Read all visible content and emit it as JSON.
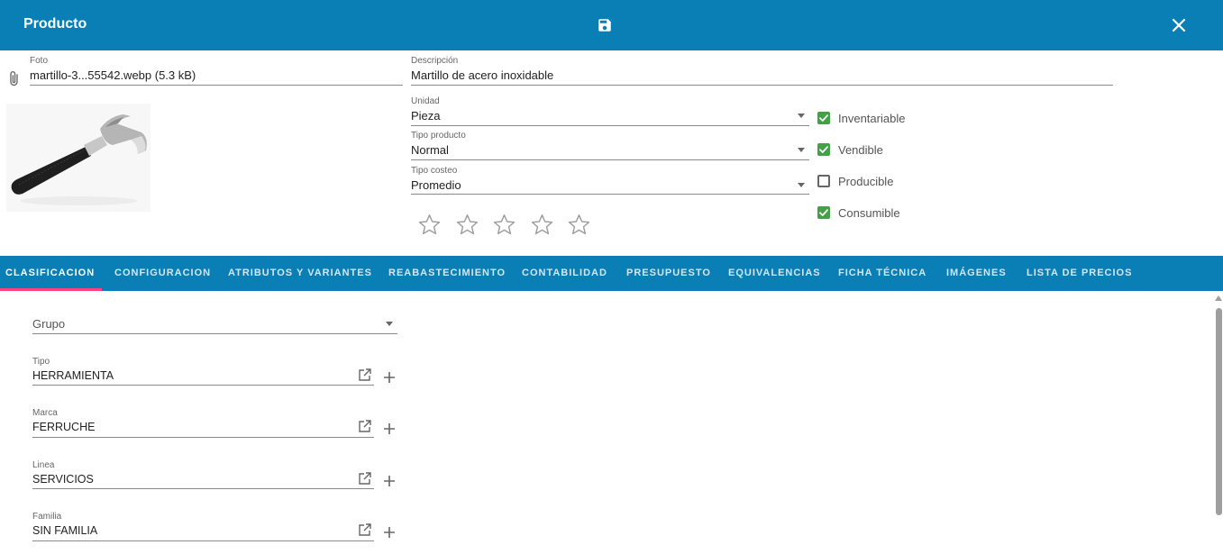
{
  "header": {
    "title": "Producto",
    "save_icon": "save-icon",
    "close_icon": "close-icon"
  },
  "form": {
    "foto": {
      "label": "Foto",
      "value": "martillo-3...55542.webp (5.3 kB)"
    },
    "descripcion": {
      "label": "Descripción",
      "value": "Martillo de acero inoxidable"
    },
    "unidad": {
      "label": "Unidad",
      "value": "Pieza"
    },
    "tipo_producto": {
      "label": "Tipo producto",
      "value": "Normal"
    },
    "tipo_costeo": {
      "label": "Tipo costeo",
      "value": "Promedio"
    },
    "rating": {
      "value": 0,
      "max": 5
    }
  },
  "checkboxes": [
    {
      "label": "Inventariable",
      "checked": true
    },
    {
      "label": "Vendible",
      "checked": true
    },
    {
      "label": "Producible",
      "checked": false
    },
    {
      "label": "Consumible",
      "checked": true
    }
  ],
  "tabs": [
    {
      "label": "CLASIFICACION",
      "active": true
    },
    {
      "label": "CONFIGURACION"
    },
    {
      "label": "ATRIBUTOS Y VARIANTES"
    },
    {
      "label": "REABASTECIMIENTO"
    },
    {
      "label": "CONTABILIDAD"
    },
    {
      "label": "PRESUPUESTO"
    },
    {
      "label": "EQUIVALENCIAS"
    },
    {
      "label": "FICHA TÉCNICA"
    },
    {
      "label": "IMÁGENES"
    },
    {
      "label": "LISTA DE PRECIOS"
    }
  ],
  "clasificacion": {
    "grupo": {
      "placeholder": "Grupo"
    },
    "tipo": {
      "label": "Tipo",
      "value": "HERRAMIENTA"
    },
    "marca": {
      "label": "Marca",
      "value": "FERRUCHE"
    },
    "linea": {
      "label": "Linea",
      "value": "SERVICIOS"
    },
    "familia": {
      "label": "Familia",
      "value": "SIN FAMILIA"
    }
  },
  "colors": {
    "primary": "#0a7fb6",
    "checkbox": "#43a047",
    "tab_indicator": "#ff4081"
  }
}
